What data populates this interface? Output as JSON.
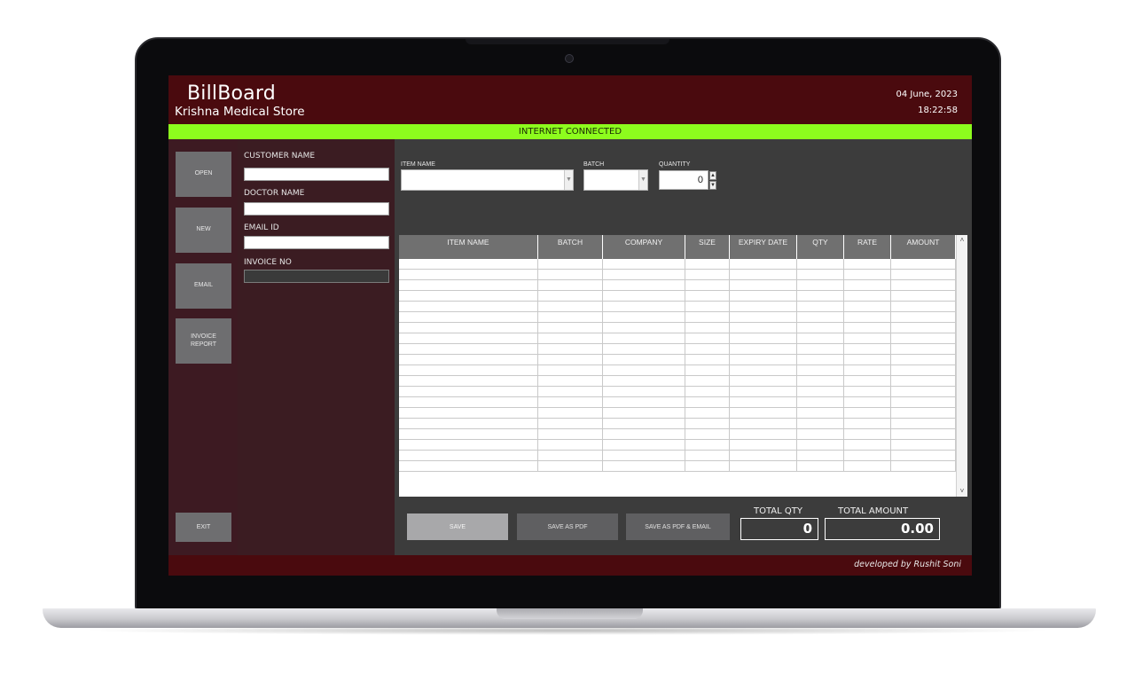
{
  "app": {
    "title": "BillBoard",
    "store_name": "Krishna Medical Store",
    "date": "04 June, 2023",
    "time": "18:22:58",
    "status": "INTERNET CONNECTED",
    "status_color": "#8dfc1d",
    "header_color": "#4a0a0e"
  },
  "sidebar": {
    "items": [
      {
        "label": "OPEN"
      },
      {
        "label": "NEW"
      },
      {
        "label": "EMAIL"
      },
      {
        "label": "INVOICE REPORT"
      }
    ],
    "exit_label": "EXIT"
  },
  "customer": {
    "customer_name_label": "CUSTOMER NAME",
    "customer_name_value": "",
    "doctor_name_label": "DOCTOR NAME",
    "doctor_name_value": "",
    "email_label": "EMAIL ID",
    "email_value": "",
    "invoice_label": "INVOICE NO",
    "invoice_value": ""
  },
  "entry": {
    "item_name_label": "ITEM NAME",
    "batch_label": "BATCH",
    "quantity_label": "QUANTITY",
    "quantity_value": "0",
    "spin_up_icon": "arrow-up-icon",
    "spin_down_icon": "arrow-down-icon"
  },
  "grid": {
    "columns": [
      "ITEM NAME",
      "BATCH",
      "COMPANY",
      "SIZE",
      "EXPIRY DATE",
      "QTY",
      "RATE",
      "AMOUNT"
    ],
    "rows": [
      [
        "",
        "",
        "",
        "",
        "",
        "",
        "",
        ""
      ]
    ]
  },
  "actions": {
    "save_label": "SAVE",
    "save_pdf_label": "SAVE AS PDF",
    "save_pdf_email_label": "SAVE AS PDF & EMAIL",
    "total_qty_label": "TOTAL QTY",
    "total_qty_value": "0",
    "total_amount_label": "TOTAL AMOUNT",
    "total_amount_value": "0.00"
  },
  "footer": {
    "credit": "developed by Rushit Soni"
  }
}
